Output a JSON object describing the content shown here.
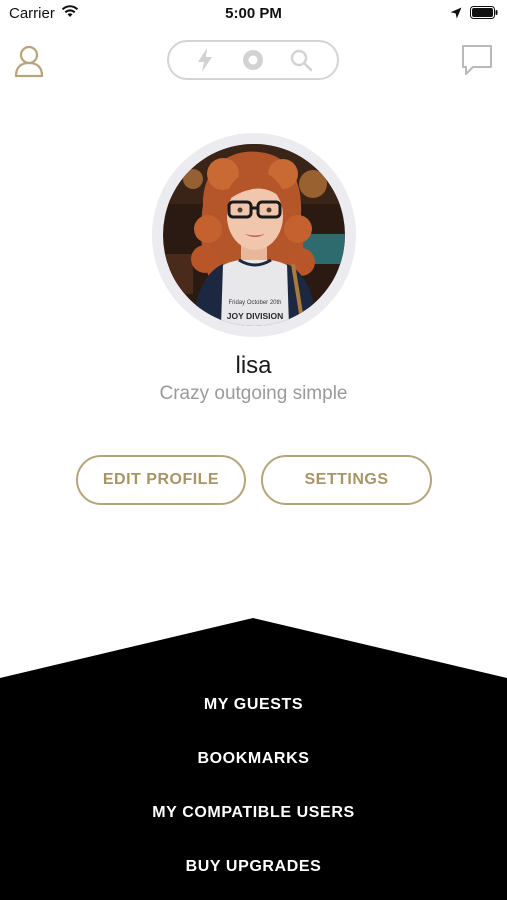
{
  "status_bar": {
    "carrier": "Carrier",
    "time": "5:00 PM"
  },
  "nav": {
    "left_icon": "profile-icon",
    "pill_icons": [
      "bolt-icon",
      "record-icon",
      "search-icon"
    ],
    "right_icon": "chat-icon"
  },
  "profile": {
    "name": "lisa",
    "tagline": "Crazy outgoing simple",
    "shirt_text_line1": "Friday October 20th",
    "shirt_text_line2": "JOY DIVISION"
  },
  "buttons": {
    "edit_profile": "EDIT PROFILE",
    "settings": "SETTINGS"
  },
  "menu": {
    "items": [
      "MY GUESTS",
      "BOOKMARKS",
      "MY COMPATIBLE USERS",
      "BUY UPGRADES"
    ]
  },
  "colors": {
    "accent_gold": "#b6a47a",
    "panel_black": "#000000",
    "pill_border": "#d4d4d4"
  }
}
